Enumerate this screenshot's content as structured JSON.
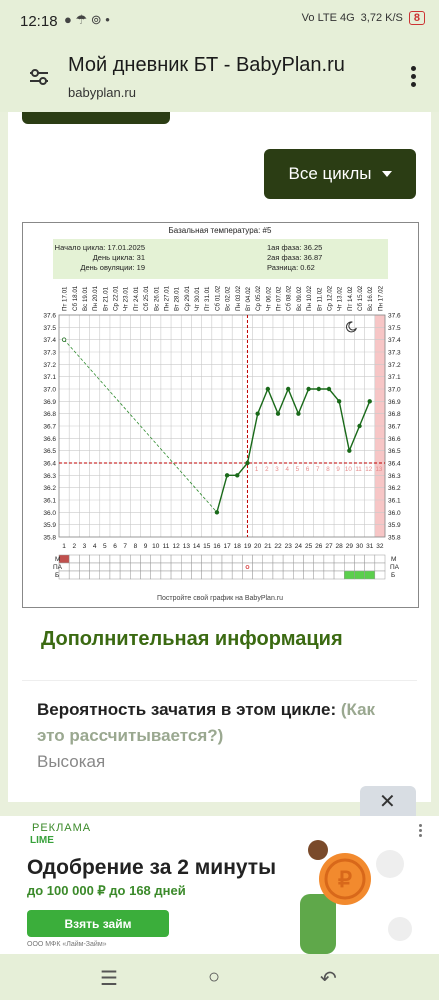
{
  "statusbar": {
    "time": "12:18",
    "icons_left": "● ☂ ⊚ •",
    "signal": "Vo LTE 4G",
    "speed": "3,72 K/S",
    "battery": "8"
  },
  "urlbar": {
    "title": "Мой дневник БТ - BabyPlan.ru",
    "domain": "babyplan.ru"
  },
  "controls": {
    "cycles_button": "Все циклы"
  },
  "chart_info": {
    "title": "Базальная температура: #5",
    "start_label": "Начало цикла: 17.01.2025",
    "day_label": "День цикла: 31",
    "ov_label": "День овуляции: 19",
    "phase1": "1ая фаза: 36.25",
    "phase2": "2ая фаза: 36.87",
    "diff": "Разница: 0.62",
    "footer": "Постройте свой график на BabyPlan.ru",
    "row_labels": [
      "М",
      "ПА",
      "Б"
    ]
  },
  "chart_data": {
    "type": "line",
    "title": "Базальная температура: #5",
    "x": [
      1,
      2,
      3,
      4,
      5,
      6,
      7,
      8,
      9,
      10,
      11,
      12,
      13,
      14,
      15,
      16,
      17,
      18,
      19,
      20,
      21,
      22,
      23,
      24,
      25,
      26,
      27,
      28,
      29,
      30,
      31,
      32
    ],
    "dates": [
      "Пт 17.01",
      "Сб 18.01",
      "Вс 19.01",
      "Пн 20.01",
      "Вт 21.01",
      "Ср 22.01",
      "Чт 23.01",
      "Пт 24.01",
      "Сб 25.01",
      "Вс 26.01",
      "Пн 27.01",
      "Вт 28.01",
      "Ср 29.01",
      "Чт 30.01",
      "Пт 31.01",
      "Сб 01.02",
      "Вс 02.02",
      "Пн 03.02",
      "Вт 04.02",
      "Ср 05.02",
      "Чт 06.02",
      "Пт 07.02",
      "Сб 08.02",
      "Вс 09.02",
      "Пн 10.02",
      "Вт 11.02",
      "Ср 12.02",
      "Чт 13.02",
      "Пт 14.02",
      "Сб 15.02",
      "Вс 16.02",
      "Пн 17.02"
    ],
    "y_ticks": [
      "35.8",
      "35.9",
      "36.0",
      "36.1",
      "36.2",
      "36.3",
      "36.4",
      "36.5",
      "36.6",
      "36.7",
      "36.8",
      "36.9",
      "37.0",
      "37.1",
      "37.2",
      "37.3",
      "37.4",
      "37.5",
      "37.6"
    ],
    "series": [
      {
        "values": [
          37.4,
          null,
          null,
          null,
          null,
          null,
          null,
          null,
          null,
          null,
          null,
          null,
          null,
          null,
          null,
          36.0,
          36.3,
          36.3,
          36.4,
          36.8,
          37.0,
          36.8,
          37.0,
          36.8,
          37.0,
          37.0,
          37.0,
          36.9,
          36.5,
          36.7,
          36.9,
          null
        ]
      }
    ],
    "coverline": 36.4,
    "ovulation_day": 19,
    "post_ovulation_labels": [
      "1",
      "2",
      "3",
      "4",
      "5",
      "6",
      "7",
      "8",
      "9",
      "10",
      "11",
      "12",
      "13"
    ],
    "ylim": [
      35.8,
      37.6
    ],
    "highlight_day": 32
  },
  "info": {
    "section_title": "Дополнительная информация",
    "prob_label": "Вероятность зачатия в этом цикле:",
    "prob_link": "(Как это рассчитывается?)",
    "prob_value": "Высокая"
  },
  "ad": {
    "label": "РЕКЛАМА",
    "brand": "LIME",
    "headline": "Одобрение за 2 минуты",
    "sub": "до 100 000 ₽  до 168 дней",
    "button": "Взять займ",
    "legal": "ООО МФК «Лайм-Займ»"
  },
  "colors": {
    "accent": "#2b3d14",
    "link": "#3b6a12",
    "line": "#1a6a1a",
    "coverline": "#c00000"
  }
}
